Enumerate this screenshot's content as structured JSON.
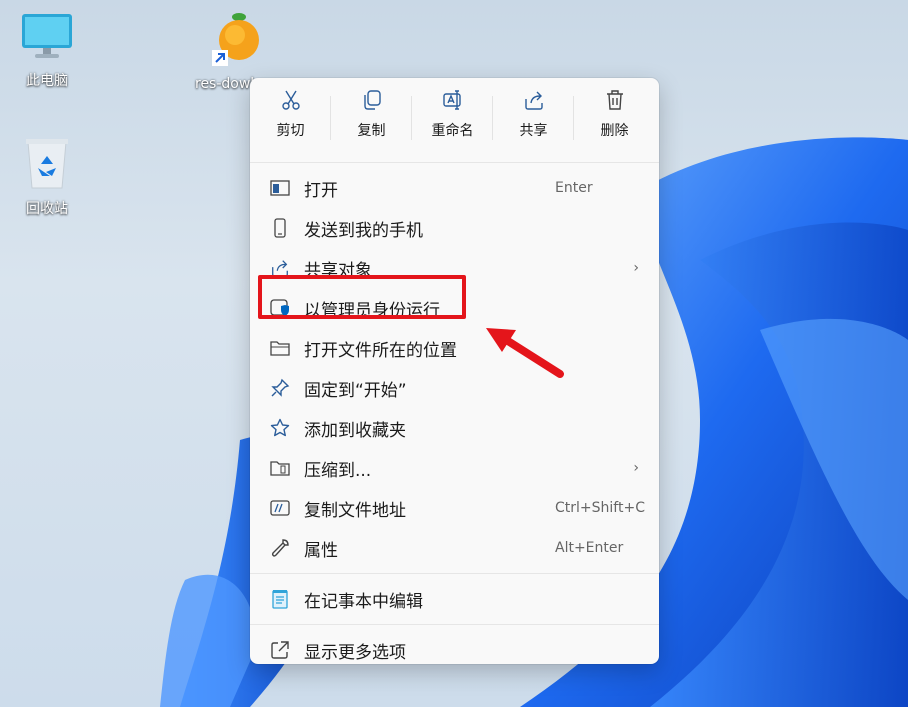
{
  "desktop": {
    "icons": [
      {
        "label": "此电脑",
        "icon": "monitor-icon"
      },
      {
        "label": "res-dowl",
        "icon": "orange-app-icon"
      },
      {
        "label": "回收站",
        "icon": "recycle-bin-icon"
      }
    ]
  },
  "quick_actions": [
    {
      "label": "剪切",
      "icon": "scissors-icon"
    },
    {
      "label": "复制",
      "icon": "copy-icon"
    },
    {
      "label": "重命名",
      "icon": "rename-icon"
    },
    {
      "label": "共享",
      "icon": "share-icon"
    },
    {
      "label": "删除",
      "icon": "trash-icon"
    }
  ],
  "menu": {
    "open": {
      "label": "打开",
      "shortcut": "Enter"
    },
    "send_phone": {
      "label": "发送到我的手机"
    },
    "share_with": {
      "label": "共享对象",
      "arrow": "›"
    },
    "run_as_admin": {
      "label": "以管理员身份运行"
    },
    "open_location": {
      "label": "打开文件所在的位置"
    },
    "pin_start": {
      "label": "固定到“开始”"
    },
    "add_favorites": {
      "label": "添加到收藏夹"
    },
    "compress": {
      "label": "压缩到...",
      "arrow": "›"
    },
    "copy_path": {
      "label": "复制文件地址",
      "shortcut": "Ctrl+Shift+C"
    },
    "properties": {
      "label": "属性",
      "shortcut": "Alt+Enter"
    },
    "edit_notepad": {
      "label": "在记事本中编辑"
    },
    "show_more": {
      "label": "显示更多选项"
    }
  },
  "colors": {
    "highlight": "#e4151b",
    "accent": "#0067c0",
    "wallpaper_blue": "#1a5fd6"
  }
}
